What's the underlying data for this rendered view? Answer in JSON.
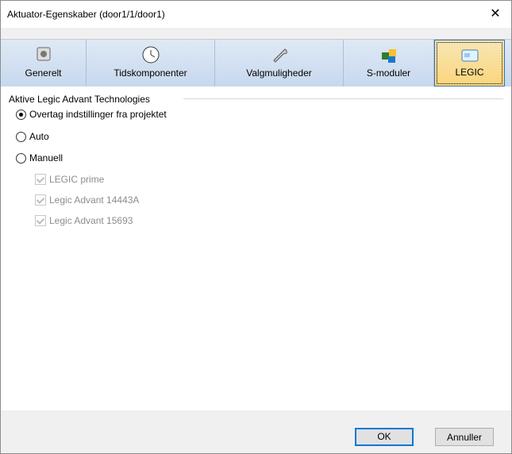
{
  "window": {
    "title": "Aktuator-Egenskaber (door1/1/door1)",
    "close": "✕"
  },
  "tabs": [
    {
      "label": "Generelt",
      "icon": "settings-icon"
    },
    {
      "label": "Tidskomponenter",
      "icon": "clock-icon"
    },
    {
      "label": "Valgmuligheder",
      "icon": "wrench-icon"
    },
    {
      "label": "S-moduler",
      "icon": "puzzle-icon"
    },
    {
      "label": "LEGIC",
      "icon": "card-icon"
    }
  ],
  "group": {
    "title": "Aktive Legic Advant Technologies",
    "options": [
      {
        "label": "Overtag indstillinger fra projektet",
        "checked": true
      },
      {
        "label": "Auto",
        "checked": false
      },
      {
        "label": "Manuell",
        "checked": false
      }
    ],
    "checks": [
      {
        "label": "LEGIC prime",
        "checked": true
      },
      {
        "label": "Legic Advant 14443A",
        "checked": true
      },
      {
        "label": "Legic Advant 15693",
        "checked": true
      }
    ]
  },
  "buttons": {
    "ok": "OK",
    "cancel": "Annuller"
  }
}
